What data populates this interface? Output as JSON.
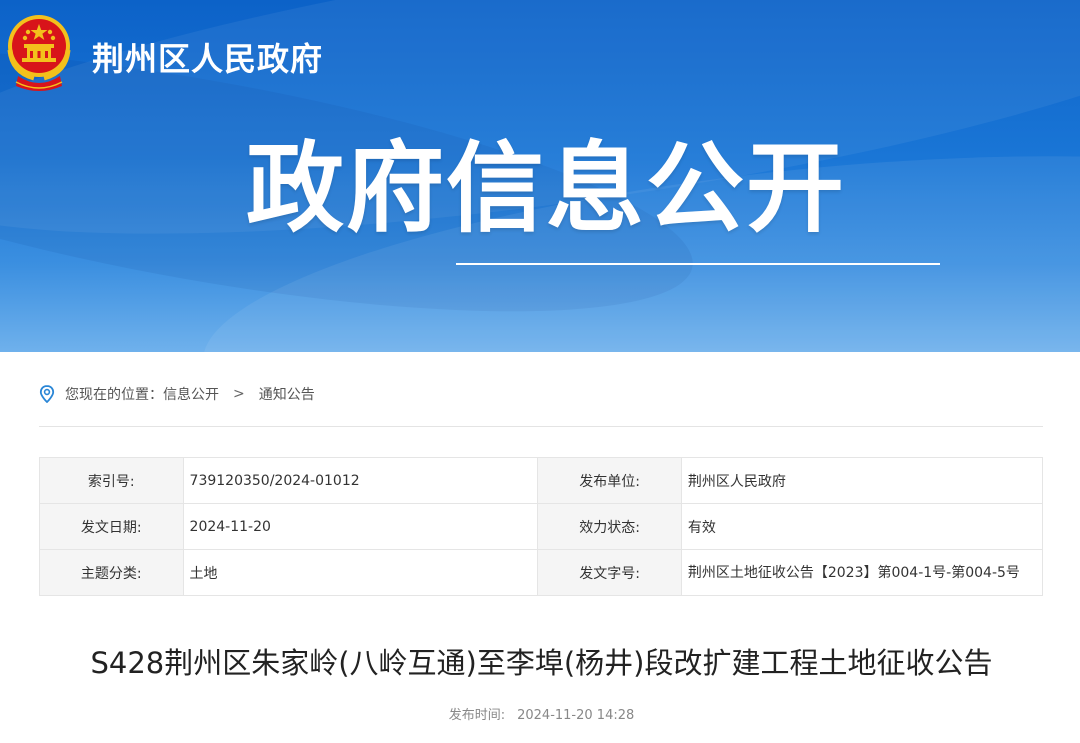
{
  "header": {
    "site_name": "荆州区人民政府",
    "hero_title": "政府信息公开",
    "emblem_icon": "national-emblem-icon",
    "colors": {
      "banner_top": "#0c62c8",
      "banner_bottom": "#6fb1ec",
      "emblem_red": "#d8141a",
      "emblem_gold": "#f3c11c"
    }
  },
  "breadcrumb": {
    "icon": "location-pin-icon",
    "prefix": "您现在的位置：",
    "items": [
      "信息公开",
      "通知公告"
    ],
    "separator": ">"
  },
  "meta": {
    "rows": [
      [
        {
          "key": "索引号:",
          "value": "739120350/2024-01012"
        },
        {
          "key": "发布单位:",
          "value": "荆州区人民政府"
        }
      ],
      [
        {
          "key": "发文日期:",
          "value": "2024-11-20"
        },
        {
          "key": "效力状态:",
          "value": "有效"
        }
      ],
      [
        {
          "key": "主题分类:",
          "value": "土地"
        },
        {
          "key": "发文字号:",
          "value": "荆州区土地征收公告【2023】第004-1号-第004-5号"
        }
      ]
    ]
  },
  "article": {
    "title": "S428荆州区朱家岭(八岭互通)至李埠(杨井)段改扩建工程土地征收公告",
    "publish_label": "发布时间:",
    "publish_time": "2024-11-20 14:28"
  }
}
